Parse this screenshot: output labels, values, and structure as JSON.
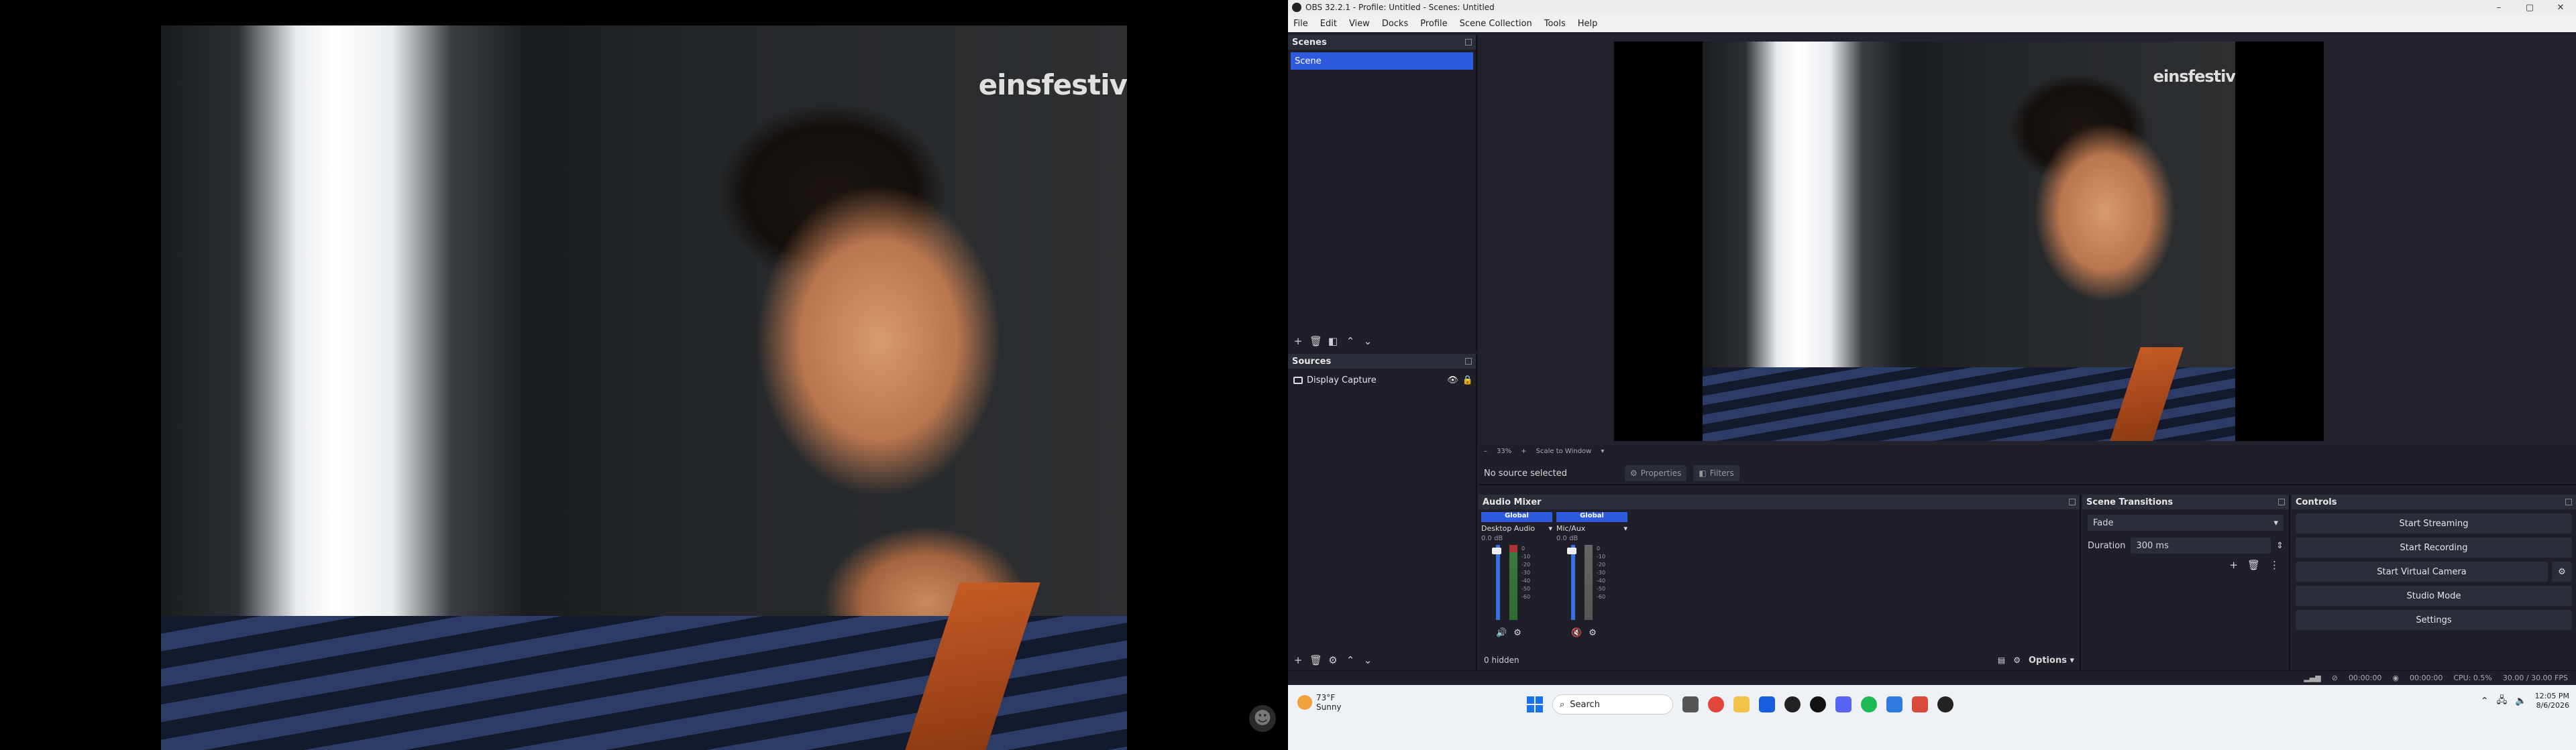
{
  "left_monitor": {
    "video_watermark": "einsfestiv"
  },
  "obs": {
    "window_title": "OBS 32.2.1 - Profile: Untitled - Scenes: Untitled",
    "window_controls": {
      "minimize": "–",
      "maximize": "▢",
      "close": "✕"
    },
    "menu": [
      "File",
      "Edit",
      "View",
      "Docks",
      "Profile",
      "Scene Collection",
      "Tools",
      "Help"
    ],
    "scenes": {
      "title": "Scenes",
      "items": [
        "Scene"
      ]
    },
    "sources": {
      "title": "Sources",
      "items": [
        {
          "name": "Display Capture"
        }
      ]
    },
    "preview": {
      "watermark": "einsfestiv",
      "zoom_minus": "–",
      "zoom_value": "33%",
      "zoom_plus": "+",
      "scale_mode": "Scale to Window"
    },
    "context_bar": {
      "no_source": "No source selected",
      "properties": "Properties",
      "filters": "Filters"
    },
    "audio_mixer": {
      "title": "Audio Mixer",
      "channels": [
        {
          "header": "Global",
          "name": "Desktop Audio",
          "db": "0.0 dB",
          "muted": false
        },
        {
          "header": "Global",
          "name": "Mic/Aux",
          "db": "0.0 dB",
          "muted": true
        }
      ],
      "tick_labels": [
        "0",
        "-5",
        "-10",
        "-15",
        "-20",
        "-25",
        "-30",
        "-35",
        "-40",
        "-45",
        "-50",
        "-55",
        "-60"
      ],
      "hidden_label": "0 hidden",
      "options_label": "Options"
    },
    "scene_transitions": {
      "title": "Scene Transitions",
      "transition": "Fade",
      "duration_label": "Duration",
      "duration_value": "300 ms"
    },
    "controls": {
      "title": "Controls",
      "start_streaming": "Start Streaming",
      "start_recording": "Start Recording",
      "start_virtual_camera": "Start Virtual Camera",
      "studio_mode": "Studio Mode",
      "settings": "Settings"
    },
    "status": {
      "stream_time": "00:00:00",
      "record_time": "00:00:00",
      "cpu": "CPU: 0.5%",
      "fps": "30.00 / 30.00 FPS"
    }
  },
  "taskbar": {
    "weather_temp": "73°F",
    "weather_cond": "Sunny",
    "search_placeholder": "Search",
    "time": "12:05 PM",
    "date": "8/6/2026"
  },
  "colors": {
    "accent": "#2f5ae0",
    "panel_bg": "#1e1f29",
    "muted_red": "#e03c3c"
  }
}
